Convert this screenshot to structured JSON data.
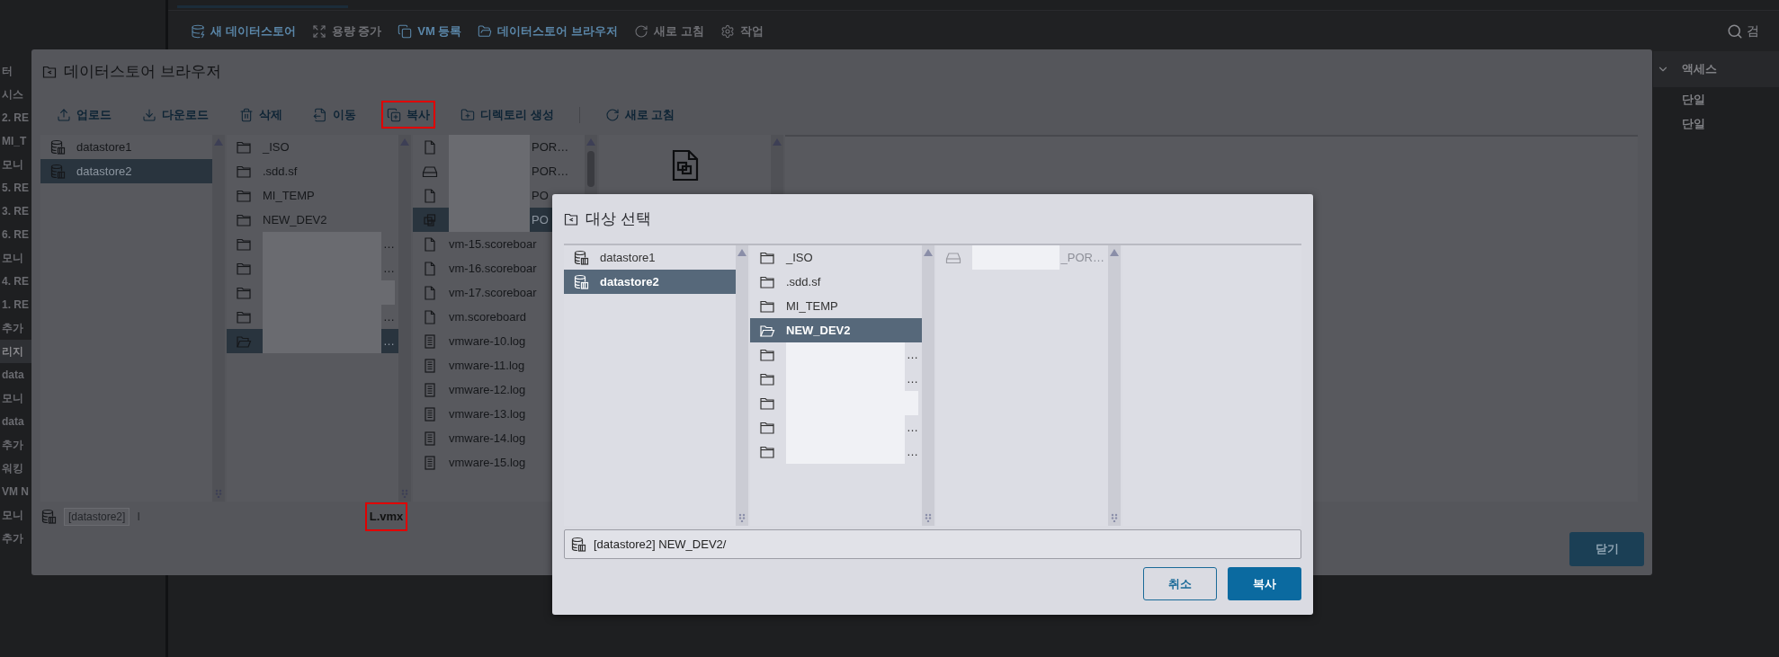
{
  "background": {
    "sidebar": [
      {
        "text": "터",
        "selected": false
      },
      {
        "text": "시스",
        "selected": false
      },
      {
        "text": "2. RE",
        "selected": false
      },
      {
        "text": "MI_T",
        "selected": false
      },
      {
        "text": "모니",
        "selected": false
      },
      {
        "text": "5. RE",
        "selected": false
      },
      {
        "text": "3. RE",
        "selected": false
      },
      {
        "text": "6. RE",
        "selected": false
      },
      {
        "text": "모니",
        "selected": false
      },
      {
        "text": "4. RE",
        "selected": false
      },
      {
        "text": "1. RE",
        "selected": false
      },
      {
        "text": "추가",
        "selected": false
      },
      {
        "text": "리지",
        "selected": true
      },
      {
        "text": "data",
        "selected": false
      },
      {
        "text": "모니",
        "selected": false
      },
      {
        "text": "data",
        "selected": false
      },
      {
        "text": "추가",
        "selected": false
      },
      {
        "text": "워킹",
        "selected": false
      },
      {
        "text": "VM N",
        "selected": false
      },
      {
        "text": "모니",
        "selected": false
      },
      {
        "text": "추가",
        "selected": false
      }
    ],
    "toolbar": [
      {
        "label": "새 데이터스토어",
        "disabled": false
      },
      {
        "label": "용량 증가",
        "disabled": true
      },
      {
        "label": "VM 등록",
        "disabled": false
      },
      {
        "label": "데이터스토어 브라우저",
        "disabled": false
      },
      {
        "label": "새로 고침",
        "disabled": true
      },
      {
        "label": "작업",
        "disabled": true
      }
    ],
    "search": "검",
    "table": {
      "column": "액세스",
      "rows": [
        "단일",
        "단일"
      ]
    }
  },
  "browser": {
    "title": "데이터스토어 브라우저",
    "toolbar": [
      {
        "label": "업로드",
        "highlighted": false
      },
      {
        "label": "다운로드",
        "highlighted": false
      },
      {
        "label": "삭제",
        "highlighted": false
      },
      {
        "label": "이동",
        "highlighted": false
      },
      {
        "label": "복사",
        "highlighted": true
      },
      {
        "label": "디렉토리 생성",
        "highlighted": false
      },
      {
        "label": "새로 고침",
        "highlighted": false
      }
    ],
    "columns": [
      {
        "items": [
          {
            "kind": "datastore",
            "name": "datastore1",
            "selected": false
          },
          {
            "kind": "datastore",
            "name": "datastore2",
            "selected": true
          }
        ]
      },
      {
        "items": [
          {
            "kind": "folder",
            "name": "_ISO",
            "selected": false
          },
          {
            "kind": "folder",
            "name": ".sdd.sf",
            "selected": false
          },
          {
            "kind": "folder",
            "name": "MI_TEMP",
            "selected": false
          },
          {
            "kind": "folder",
            "name": "NEW_DEV2",
            "selected": false
          },
          {
            "kind": "folder",
            "redacted": true,
            "tail": "…",
            "selected": false
          },
          {
            "kind": "folder",
            "redacted": true,
            "tail": "…",
            "selected": false
          },
          {
            "kind": "folder",
            "redacted": true,
            "selected": false
          },
          {
            "kind": "folder",
            "redacted": true,
            "tail": "…",
            "selected": false
          },
          {
            "kind": "folder",
            "redacted": true,
            "tail": "…",
            "selected": true
          }
        ]
      },
      {
        "items": [
          {
            "kind": "file",
            "redacted": true,
            "tail": "POR…",
            "selected": false
          },
          {
            "kind": "disk",
            "redacted": true,
            "tail": "POR…",
            "selected": false
          },
          {
            "kind": "file",
            "redacted": true,
            "tail": "PO",
            "selected": false
          },
          {
            "kind": "vm",
            "redacted": true,
            "tail": "PO",
            "selected": true
          },
          {
            "kind": "file",
            "name": "vm-15.scoreboar",
            "selected": false
          },
          {
            "kind": "file",
            "name": "vm-16.scoreboar",
            "selected": false
          },
          {
            "kind": "file",
            "name": "vm-17.scoreboar",
            "selected": false
          },
          {
            "kind": "file",
            "name": "vm.scoreboard",
            "selected": false
          },
          {
            "kind": "log",
            "name": "vmware-10.log",
            "selected": false
          },
          {
            "kind": "log",
            "name": "vmware-11.log",
            "selected": false
          },
          {
            "kind": "log",
            "name": "vmware-12.log",
            "selected": false
          },
          {
            "kind": "log",
            "name": "vmware-13.log",
            "selected": false
          },
          {
            "kind": "log",
            "name": "vmware-14.log",
            "selected": false
          },
          {
            "kind": "log",
            "name": "vmware-15.log",
            "selected": false
          }
        ]
      }
    ],
    "preview": {
      "kind": "vm"
    },
    "path_chip": "[datastore2]",
    "path_rest": "I",
    "file_name": {
      "text": "L.vmx",
      "highlighted": true
    },
    "close": "닫기"
  },
  "target_dialog": {
    "title": "대상 선택",
    "columns": [
      {
        "items": [
          {
            "kind": "datastore",
            "name": "datastore1",
            "selected": false
          },
          {
            "kind": "datastore",
            "name": "datastore2",
            "selected": true
          }
        ]
      },
      {
        "items": [
          {
            "kind": "folder",
            "name": "_ISO",
            "selected": false
          },
          {
            "kind": "folder",
            "name": ".sdd.sf",
            "selected": false
          },
          {
            "kind": "folder",
            "name": "MI_TEMP",
            "selected": false
          },
          {
            "kind": "folder",
            "name": "NEW_DEV2",
            "selected": true
          },
          {
            "kind": "folder",
            "redacted": true,
            "tail": "…",
            "selected": false
          },
          {
            "kind": "folder",
            "redacted": true,
            "tail": "…",
            "selected": false
          },
          {
            "kind": "folder",
            "redacted": true,
            "selected": false
          },
          {
            "kind": "folder",
            "redacted": true,
            "tail": "…",
            "selected": false
          },
          {
            "kind": "folder",
            "redacted": true,
            "tail": "…",
            "selected": false
          }
        ]
      },
      {
        "items": [
          {
            "kind": "disk",
            "redacted": true,
            "tail": "_POR…",
            "disabled": true,
            "selected": false
          }
        ]
      }
    ],
    "path": "[datastore2] NEW_DEV2/",
    "buttons": [
      {
        "label": "취소",
        "primary": false
      },
      {
        "label": "복사",
        "primary": true
      }
    ]
  }
}
